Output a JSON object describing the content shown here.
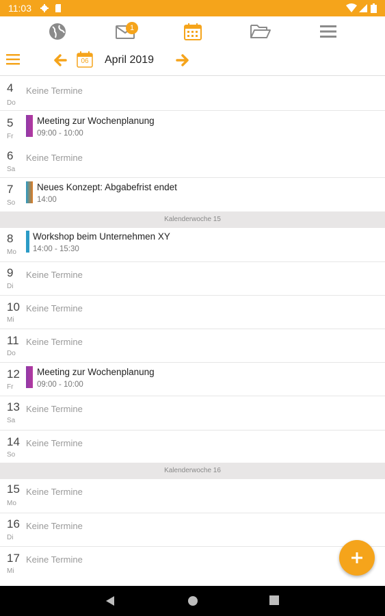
{
  "status": {
    "time": "11:03"
  },
  "header": {
    "month": "April 2019",
    "calendar_badge_day": "06",
    "mail_badge": "1"
  },
  "colors": {
    "accent": "#f5a41b",
    "purple": "#8e3aa8",
    "magenta": "#b5399f",
    "teal": "#2b9bc6",
    "orange": "#e07b20"
  },
  "days": [
    {
      "num": "4",
      "name": "Do",
      "empty": "Keine Termine"
    },
    {
      "num": "5",
      "name": "Fr",
      "event": {
        "title": "Meeting zur Wochenplanung",
        "time": "09:00 - 10:00"
      }
    },
    {
      "num": "6",
      "name": "Sa",
      "empty": "Keine Termine"
    },
    {
      "num": "7",
      "name": "So",
      "event": {
        "title": "Neues Konzept: Abgabefrist endet",
        "time": "14:00"
      }
    },
    {
      "week": "Kalenderwoche 15"
    },
    {
      "num": "8",
      "name": "Mo",
      "event": {
        "title": "Workshop beim Unternehmen XY",
        "time": "14:00 - 15:30"
      }
    },
    {
      "num": "9",
      "name": "Di",
      "empty": "Keine Termine"
    },
    {
      "num": "10",
      "name": "Mi",
      "empty": "Keine Termine"
    },
    {
      "num": "11",
      "name": "Do",
      "empty": "Keine Termine"
    },
    {
      "num": "12",
      "name": "Fr",
      "event": {
        "title": "Meeting zur Wochenplanung",
        "time": "09:00 - 10:00"
      }
    },
    {
      "num": "13",
      "name": "Sa",
      "empty": "Keine Termine"
    },
    {
      "num": "14",
      "name": "So",
      "empty": "Keine Termine"
    },
    {
      "week": "Kalenderwoche 16"
    },
    {
      "num": "15",
      "name": "Mo",
      "empty": "Keine Termine"
    },
    {
      "num": "16",
      "name": "Di",
      "empty": "Keine Termine"
    },
    {
      "num": "17",
      "name": "Mi",
      "empty": "Keine Termine"
    }
  ]
}
